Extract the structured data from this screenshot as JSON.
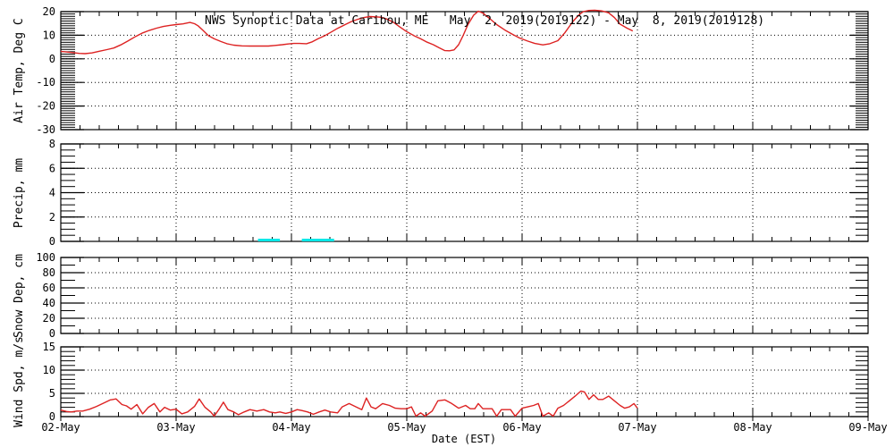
{
  "title": "NWS Synoptic Data at Caribou, ME   May  2, 2019(2019122) - May  8, 2019(2019128)",
  "xlabel": "Date (EST)",
  "colors": {
    "line": "#dd2222",
    "precip": "#00e8e8",
    "axis": "#000000",
    "background": "#ffffff"
  },
  "x_axis": {
    "lim": [
      0,
      7
    ],
    "minor_per_day": 6,
    "tick_labels": [
      "02-May",
      "03-May",
      "04-May",
      "05-May",
      "06-May",
      "07-May",
      "08-May",
      "09-May"
    ]
  },
  "chart_data": [
    {
      "type": "line",
      "name": "air-temperature",
      "ylabel": "Air Temp, Deg C",
      "ylim": [
        -30,
        20
      ],
      "minor_step": 1,
      "grid": [
        10,
        0,
        -10,
        -20
      ],
      "yticks": [
        {
          "v": 20,
          "label": "20"
        },
        {
          "v": 10,
          "label": "10"
        },
        {
          "v": 0,
          "label": "0"
        },
        {
          "v": -10,
          "label": "-10"
        },
        {
          "v": -20,
          "label": "-20"
        },
        {
          "v": -30,
          "label": "-30"
        }
      ],
      "points": [
        [
          0,
          3.2
        ],
        [
          0.09,
          2.7
        ],
        [
          0.16,
          2.3
        ],
        [
          0.21,
          2.2
        ],
        [
          0.27,
          2.5
        ],
        [
          0.33,
          3.2
        ],
        [
          0.4,
          3.9
        ],
        [
          0.46,
          4.6
        ],
        [
          0.52,
          5.9
        ],
        [
          0.58,
          7.5
        ],
        [
          0.65,
          9.5
        ],
        [
          0.71,
          11
        ],
        [
          0.77,
          12.1
        ],
        [
          0.83,
          13
        ],
        [
          0.89,
          13.7
        ],
        [
          0.95,
          14.2
        ],
        [
          1,
          14.5
        ],
        [
          1.06,
          14.8
        ],
        [
          1.12,
          15.4
        ],
        [
          1.16,
          14.9
        ],
        [
          1.19,
          14
        ],
        [
          1.23,
          12.2
        ],
        [
          1.28,
          9.8
        ],
        [
          1.33,
          8.5
        ],
        [
          1.39,
          7.3
        ],
        [
          1.44,
          6.4
        ],
        [
          1.5,
          5.8
        ],
        [
          1.57,
          5.5
        ],
        [
          1.64,
          5.4
        ],
        [
          1.72,
          5.4
        ],
        [
          1.8,
          5.4
        ],
        [
          1.86,
          5.7
        ],
        [
          1.92,
          6
        ],
        [
          1.97,
          6.3
        ],
        [
          2.02,
          6.5
        ],
        [
          2.07,
          6.5
        ],
        [
          2.13,
          6.4
        ],
        [
          2.18,
          7.2
        ],
        [
          2.23,
          8.5
        ],
        [
          2.29,
          9.8
        ],
        [
          2.34,
          11.2
        ],
        [
          2.4,
          12.9
        ],
        [
          2.47,
          14.6
        ],
        [
          2.52,
          15.8
        ],
        [
          2.58,
          16.8
        ],
        [
          2.63,
          17.5
        ],
        [
          2.68,
          17.9
        ],
        [
          2.73,
          17.8
        ],
        [
          2.78,
          17.6
        ],
        [
          2.83,
          16.8
        ],
        [
          2.89,
          15.3
        ],
        [
          2.94,
          13.5
        ],
        [
          3,
          11.5
        ],
        [
          3.06,
          9.9
        ],
        [
          3.12,
          8.5
        ],
        [
          3.17,
          7.2
        ],
        [
          3.23,
          6
        ],
        [
          3.28,
          4.7
        ],
        [
          3.33,
          3.5
        ],
        [
          3.37,
          3.4
        ],
        [
          3.41,
          3.8
        ],
        [
          3.45,
          6
        ],
        [
          3.49,
          10
        ],
        [
          3.53,
          14.5
        ],
        [
          3.58,
          18.5
        ],
        [
          3.62,
          20.2
        ],
        [
          3.66,
          19.4
        ],
        [
          3.72,
          17
        ],
        [
          3.78,
          14.5
        ],
        [
          3.85,
          12.2
        ],
        [
          3.92,
          10.3
        ],
        [
          3.98,
          8.8
        ],
        [
          4.05,
          7.5
        ],
        [
          4.11,
          6.5
        ],
        [
          4.18,
          5.9
        ],
        [
          4.24,
          6.4
        ],
        [
          4.31,
          7.7
        ],
        [
          4.37,
          11
        ],
        [
          4.44,
          15.8
        ],
        [
          4.49,
          18.5
        ],
        [
          4.53,
          20
        ],
        [
          4.58,
          20.5
        ],
        [
          4.63,
          20.6
        ],
        [
          4.69,
          20.3
        ],
        [
          4.75,
          19.5
        ],
        [
          4.8,
          17.5
        ],
        [
          4.85,
          14.7
        ],
        [
          4.91,
          13
        ],
        [
          4.96,
          11.8
        ]
      ]
    },
    {
      "type": "bar",
      "name": "precipitation",
      "ylabel": "Precip, mm",
      "ylim": [
        0,
        8
      ],
      "minor_step": 0.5,
      "grid": [
        6,
        4,
        2
      ],
      "yticks": [
        {
          "v": 8,
          "label": "8"
        },
        {
          "v": 6,
          "label": "6"
        },
        {
          "v": 4,
          "label": "4"
        },
        {
          "v": 2,
          "label": "2"
        },
        {
          "v": 0,
          "label": "0"
        }
      ],
      "bars": [
        {
          "start": 1.71,
          "end": 1.9,
          "value": 0.1
        },
        {
          "start": 2.09,
          "end": 2.37,
          "value": 0.1
        }
      ]
    },
    {
      "type": "line",
      "name": "snow-depth",
      "ylabel": "Snow Dep, cm",
      "ylim": [
        0,
        100
      ],
      "minor_step": 10,
      "grid": [
        80,
        60,
        40,
        20
      ],
      "yticks": [
        {
          "v": 100,
          "label": "100"
        },
        {
          "v": 80,
          "label": "80"
        },
        {
          "v": 60,
          "label": "60"
        },
        {
          "v": 40,
          "label": "40"
        },
        {
          "v": 20,
          "label": "20"
        },
        {
          "v": 0,
          "label": "0"
        }
      ],
      "points": []
    },
    {
      "type": "line",
      "name": "wind-speed",
      "ylabel": "Wind Spd, m/s",
      "ylim": [
        0,
        15
      ],
      "minor_step": 1,
      "grid": [
        10,
        5
      ],
      "yticks": [
        {
          "v": 15,
          "label": "15"
        },
        {
          "v": 10,
          "label": "10"
        },
        {
          "v": 5,
          "label": "5"
        },
        {
          "v": 0,
          "label": "0"
        }
      ],
      "points": [
        [
          0,
          1.4
        ],
        [
          0.05,
          1.1
        ],
        [
          0.09,
          1
        ],
        [
          0.14,
          1.2
        ],
        [
          0.19,
          1.2
        ],
        [
          0.25,
          1.6
        ],
        [
          0.31,
          2.2
        ],
        [
          0.38,
          3
        ],
        [
          0.43,
          3.6
        ],
        [
          0.48,
          3.8
        ],
        [
          0.53,
          2.6
        ],
        [
          0.57,
          2.3
        ],
        [
          0.61,
          1.6
        ],
        [
          0.66,
          2.6
        ],
        [
          0.71,
          0.6
        ],
        [
          0.76,
          2
        ],
        [
          0.81,
          2.8
        ],
        [
          0.86,
          1
        ],
        [
          0.9,
          2
        ],
        [
          0.95,
          1.4
        ],
        [
          1,
          1.6
        ],
        [
          1.05,
          0.6
        ],
        [
          1.1,
          1
        ],
        [
          1.16,
          2.2
        ],
        [
          1.2,
          3.8
        ],
        [
          1.25,
          2
        ],
        [
          1.3,
          1
        ],
        [
          1.33,
          0.1
        ],
        [
          1.37,
          1.5
        ],
        [
          1.41,
          3.1
        ],
        [
          1.45,
          1.5
        ],
        [
          1.5,
          1
        ],
        [
          1.54,
          0.4
        ],
        [
          1.59,
          1
        ],
        [
          1.64,
          1.5
        ],
        [
          1.7,
          1.2
        ],
        [
          1.76,
          1.5
        ],
        [
          1.81,
          1
        ],
        [
          1.86,
          0.8
        ],
        [
          1.9,
          1
        ],
        [
          1.95,
          0.7
        ],
        [
          2,
          1
        ],
        [
          2.05,
          1.5
        ],
        [
          2.09,
          1.3
        ],
        [
          2.14,
          1
        ],
        [
          2.19,
          0.5
        ],
        [
          2.24,
          1
        ],
        [
          2.29,
          1.4
        ],
        [
          2.34,
          1
        ],
        [
          2.4,
          0.8
        ],
        [
          2.44,
          2.1
        ],
        [
          2.5,
          2.8
        ],
        [
          2.56,
          2.1
        ],
        [
          2.61,
          1.5
        ],
        [
          2.65,
          4
        ],
        [
          2.69,
          2.1
        ],
        [
          2.73,
          1.7
        ],
        [
          2.79,
          2.8
        ],
        [
          2.85,
          2.4
        ],
        [
          2.9,
          1.8
        ],
        [
          2.95,
          1.7
        ],
        [
          3,
          1.7
        ],
        [
          3.04,
          2.1
        ],
        [
          3.08,
          0.1
        ],
        [
          3.12,
          0.8
        ],
        [
          3.16,
          0.1
        ],
        [
          3.22,
          1.2
        ],
        [
          3.27,
          3.4
        ],
        [
          3.33,
          3.6
        ],
        [
          3.39,
          2.8
        ],
        [
          3.45,
          1.8
        ],
        [
          3.51,
          2.4
        ],
        [
          3.55,
          1.7
        ],
        [
          3.59,
          1.7
        ],
        [
          3.62,
          2.8
        ],
        [
          3.66,
          1.7
        ],
        [
          3.7,
          1.7
        ],
        [
          3.74,
          1.7
        ],
        [
          3.78,
          0.1
        ],
        [
          3.82,
          1.5
        ],
        [
          3.86,
          1.5
        ],
        [
          3.9,
          1.5
        ],
        [
          3.94,
          0.1
        ],
        [
          4,
          1.8
        ],
        [
          4.05,
          2.1
        ],
        [
          4.1,
          2.4
        ],
        [
          4.14,
          2.8
        ],
        [
          4.18,
          0.1
        ],
        [
          4.23,
          0.8
        ],
        [
          4.27,
          0.1
        ],
        [
          4.31,
          1.8
        ],
        [
          4.36,
          2.4
        ],
        [
          4.41,
          3.4
        ],
        [
          4.46,
          4.4
        ],
        [
          4.51,
          5.5
        ],
        [
          4.54,
          5.3
        ],
        [
          4.58,
          3.7
        ],
        [
          4.62,
          4.7
        ],
        [
          4.66,
          3.7
        ],
        [
          4.7,
          3.7
        ],
        [
          4.75,
          4.4
        ],
        [
          4.8,
          3.4
        ],
        [
          4.85,
          2.4
        ],
        [
          4.89,
          1.8
        ],
        [
          4.93,
          2.1
        ],
        [
          4.97,
          2.8
        ],
        [
          5,
          1.8
        ]
      ]
    }
  ]
}
